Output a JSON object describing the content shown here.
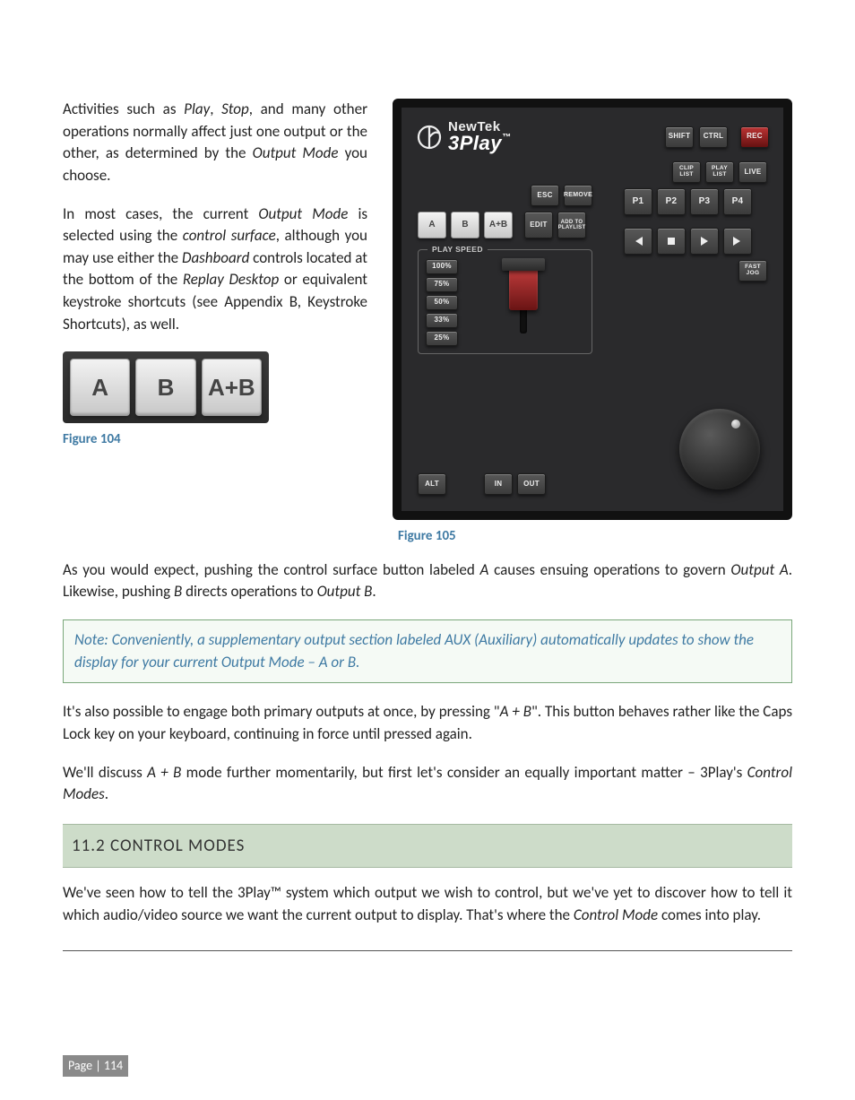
{
  "body": {
    "p1a": "Activities such as ",
    "p1_play": "Play",
    "p1b": ", ",
    "p1_stop": "Stop",
    "p1c": ", and many other operations normally affect just one output or the other, as determined by the ",
    "p1_outmode": "Output Mode",
    "p1d": " you choose.",
    "p2a": "In most cases, the current ",
    "p2_om": "Output Mode",
    "p2b": " is selected using the ",
    "p2_cs": "control surface",
    "p2c": ", although you may use either the ",
    "p2_db": "Dashboard",
    "p2d": " controls located at the bottom of the ",
    "p2_rd": "Replay Desktop",
    "p2e": " or equivalent keystroke shortcuts (see Appendix B, Keystroke Shortcuts), as well.",
    "p3a": "As you would expect, pushing the control surface button labeled ",
    "p3_A": "A",
    "p3b": " causes ensuing operations to govern ",
    "p3_OA": "Output A",
    "p3c": ".  Likewise, pushing ",
    "p3_B": "B",
    "p3d": " directs operations to ",
    "p3_OB": "Output B",
    "p3e": ".",
    "note": "Note: Conveniently, a supplementary output section labeled AUX (Auxiliary) automatically updates to show the display for your current Output Mode – A or B.",
    "p4a": "It's also possible to engage both primary outputs at once, by pressing \"",
    "p4_AB": "A + B",
    "p4b": "\". This button behaves rather like the Caps Lock key on your keyboard, continuing in force until pressed again.",
    "p5a": "We'll discuss ",
    "p5_ab": "A + B",
    "p5b": " mode further momentarily, but first let's consider an equally important matter – 3Play's ",
    "p5_cm": "Control Modes",
    "p5c": ".",
    "sect": "11.2  CONTROL MODES",
    "p6a": "We've seen how to tell the 3Play™ system which output we wish to control, but we've yet to discover how to tell it which audio/video source we want the current output to display.  That's where the ",
    "p6_cm": "Control Mode",
    "p6b": " comes into play."
  },
  "fig104": {
    "keys": {
      "a": "A",
      "b": "B",
      "ab": "A+B"
    },
    "caption": "Figure 104"
  },
  "fig105": {
    "caption": "Figure 105",
    "brand_top": "NewTek",
    "brand_main": "3Play",
    "mods": {
      "shift": "SHIFT",
      "ctrl": "CTRL",
      "rec": "REC"
    },
    "left_top": {
      "esc": "ESC",
      "remove": "REMOVE"
    },
    "left_main": {
      "a": "A",
      "b": "B",
      "ab": "A+B",
      "edit": "EDIT",
      "addto": "ADD TO\nPLAYLIST"
    },
    "speed_label": "PLAY SPEED",
    "speeds": [
      "100%",
      "75%",
      "50%",
      "33%",
      "25%"
    ],
    "alt": "ALT",
    "in": "IN",
    "out": "OUT",
    "right_top": {
      "clip": "CLIP\nLIST",
      "play": "PLAY\nLIST",
      "live": "LIVE"
    },
    "right_p": {
      "p1": "P1",
      "p2": "P2",
      "p3": "P3",
      "p4": "P4"
    },
    "fast_jog": "FAST\nJOG"
  },
  "page": "Page | 114"
}
